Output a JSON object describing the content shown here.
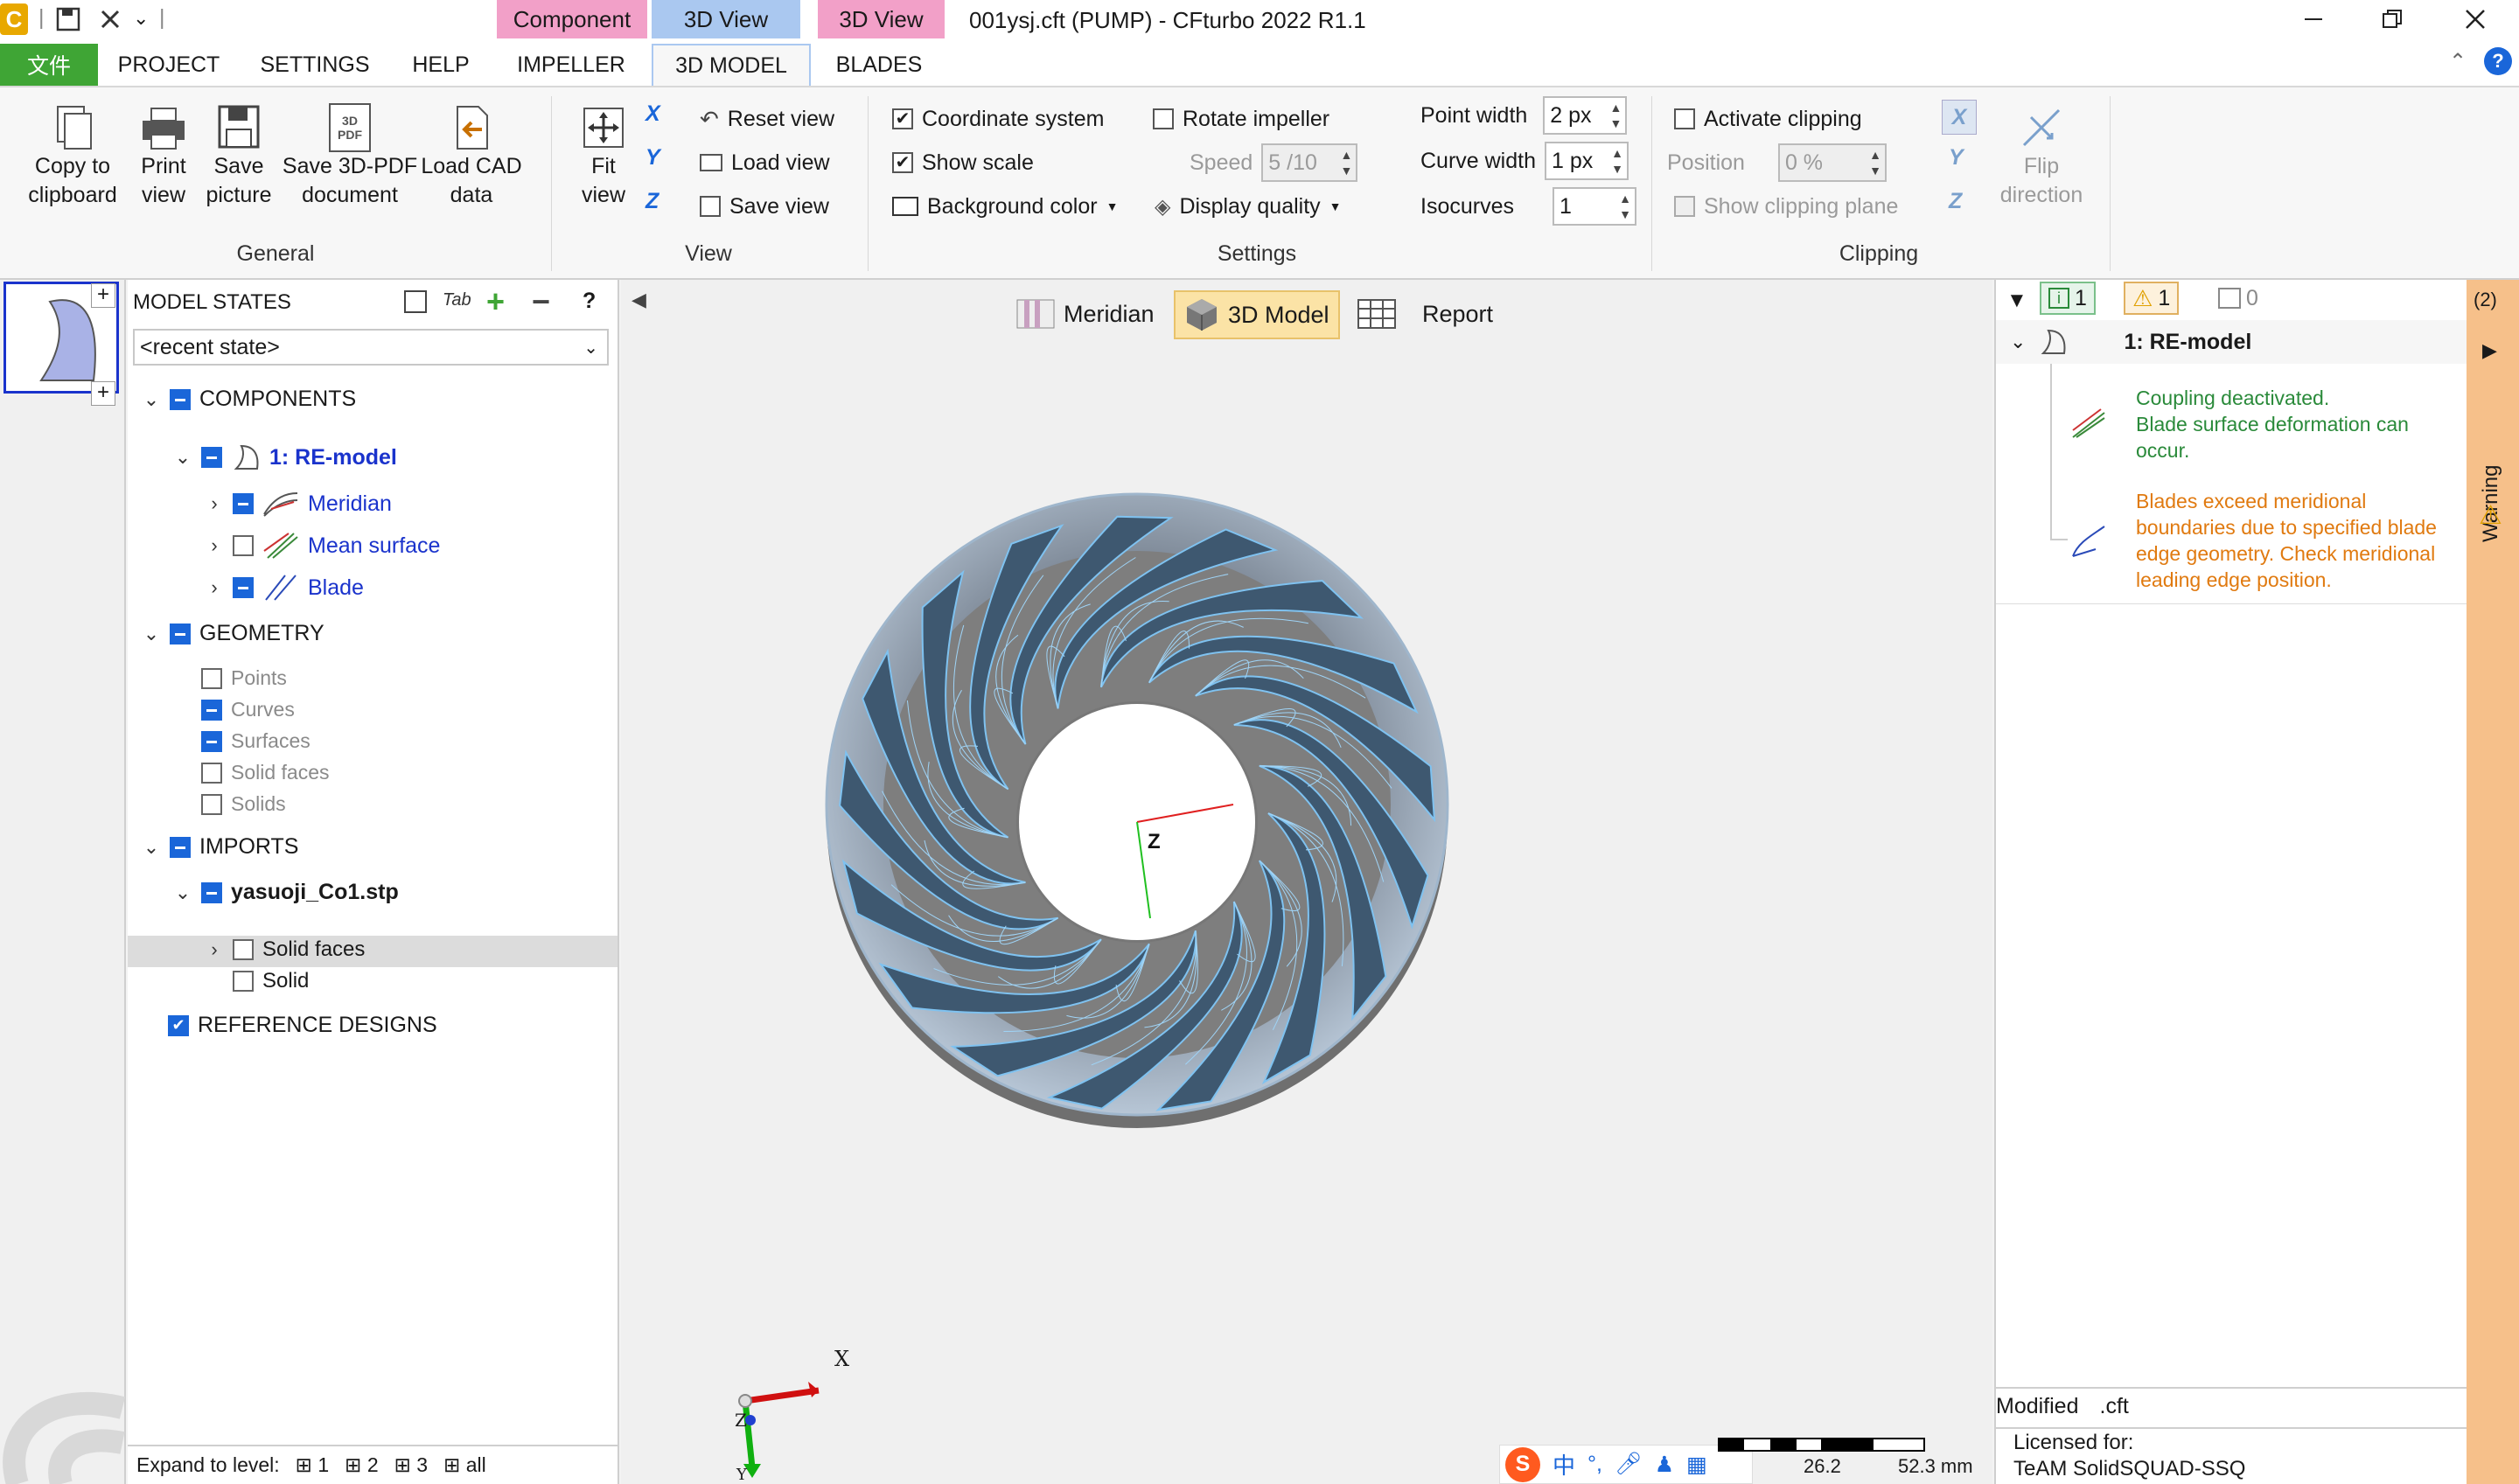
{
  "app": {
    "title": "001ysj.cft (PUMP) - CFturbo 2022 R1.1",
    "file_tab": "文件",
    "quick_access_sep": "|"
  },
  "context_headers": {
    "component": "Component",
    "view3d_a": "3D View",
    "view3d_b": "3D View"
  },
  "tabs": [
    "PROJECT",
    "SETTINGS",
    "HELP",
    "IMPELLER",
    "3D MODEL",
    "BLADES"
  ],
  "ribbon": {
    "general": {
      "label": "General",
      "copy": "Copy to\nclipboard",
      "print": "Print\nview",
      "save_picture": "Save\npicture",
      "save_3dpdf": "Save 3D-PDF\ndocument",
      "load_cad": "Load CAD\ndata",
      "pdf_icon_text": "3D\nPDF"
    },
    "view": {
      "label": "View",
      "fit": "Fit\nview",
      "reset": "Reset view",
      "load": "Load view",
      "save": "Save view",
      "axis_x": "X",
      "axis_y": "Y",
      "axis_z": "Z"
    },
    "settings": {
      "label": "Settings",
      "coordinate_system": "Coordinate system",
      "show_scale": "Show scale",
      "background_color": "Background color",
      "rotate_impeller": "Rotate impeller",
      "speed_label": "Speed",
      "speed_value": "5 /10",
      "display_quality": "Display quality",
      "point_width_label": "Point width",
      "point_width_value": "2 px",
      "curve_width_label": "Curve width",
      "curve_width_value": "1 px",
      "isocurves_label": "Isocurves",
      "isocurves_value": "1"
    },
    "clipping": {
      "label": "Clipping",
      "activate": "Activate clipping",
      "position_label": "Position",
      "position_value": "0 %",
      "show_plane": "Show clipping plane",
      "flip": "Flip\ndirection",
      "axis_x": "X",
      "axis_y": "Y",
      "axis_z": "Z"
    }
  },
  "tree": {
    "header": "MODEL STATES",
    "help": "?",
    "tab_icon": "Tab",
    "state_select": "<recent state>",
    "components": "COMPONENTS",
    "re_model": "1: RE-model",
    "meridian": "Meridian",
    "mean_surface": "Mean surface",
    "blade": "Blade",
    "geometry": "GEOMETRY",
    "geo_items": [
      "Points",
      "Curves",
      "Surfaces",
      "Solid faces",
      "Solids"
    ],
    "imports": "IMPORTS",
    "import_file": "yasuoji_Co1.stp",
    "solid_faces": "Solid faces",
    "solid": "Solid",
    "reference": "REFERENCE DESIGNS",
    "expand_label": "Expand to level:",
    "levels": [
      "1",
      "2",
      "3",
      "all"
    ]
  },
  "viewport": {
    "tabs": [
      "Meridian",
      "3D Model",
      "Report"
    ],
    "active_tab": "3D Model",
    "scale_mid": "26.2",
    "scale_end": "52.3 mm",
    "axis_x": "X",
    "axis_y": "Y",
    "axis_z": "Z",
    "ime_text": "中"
  },
  "messages": {
    "info_count": "1",
    "warn_count": "1",
    "other_count": "0",
    "root": "1: RE-model",
    "msg1": "Coupling deactivated.\nBlade surface deformation can\noccur.",
    "msg2": "Blades exceed meridional\nboundaries due to specified blade\nedge geometry. Check meridional\nleading edge position.",
    "status_modified": "Modified",
    "status_ext": ".cft",
    "licensed_label": "Licensed for:",
    "licensed_to": "TeAM SolidSQUAD-SSQ",
    "warning_tab": "Warning",
    "warning_count": "(2)"
  },
  "colors": {
    "file_tab": "#3fa535",
    "component_ctx": "#f2a0c8",
    "view_ctx": "#aac8f0",
    "accent_blue": "#1a66d9",
    "info_green": "#2a8a3a",
    "warn_orange": "#e07a10",
    "warning_strip": "#f6c08a"
  }
}
